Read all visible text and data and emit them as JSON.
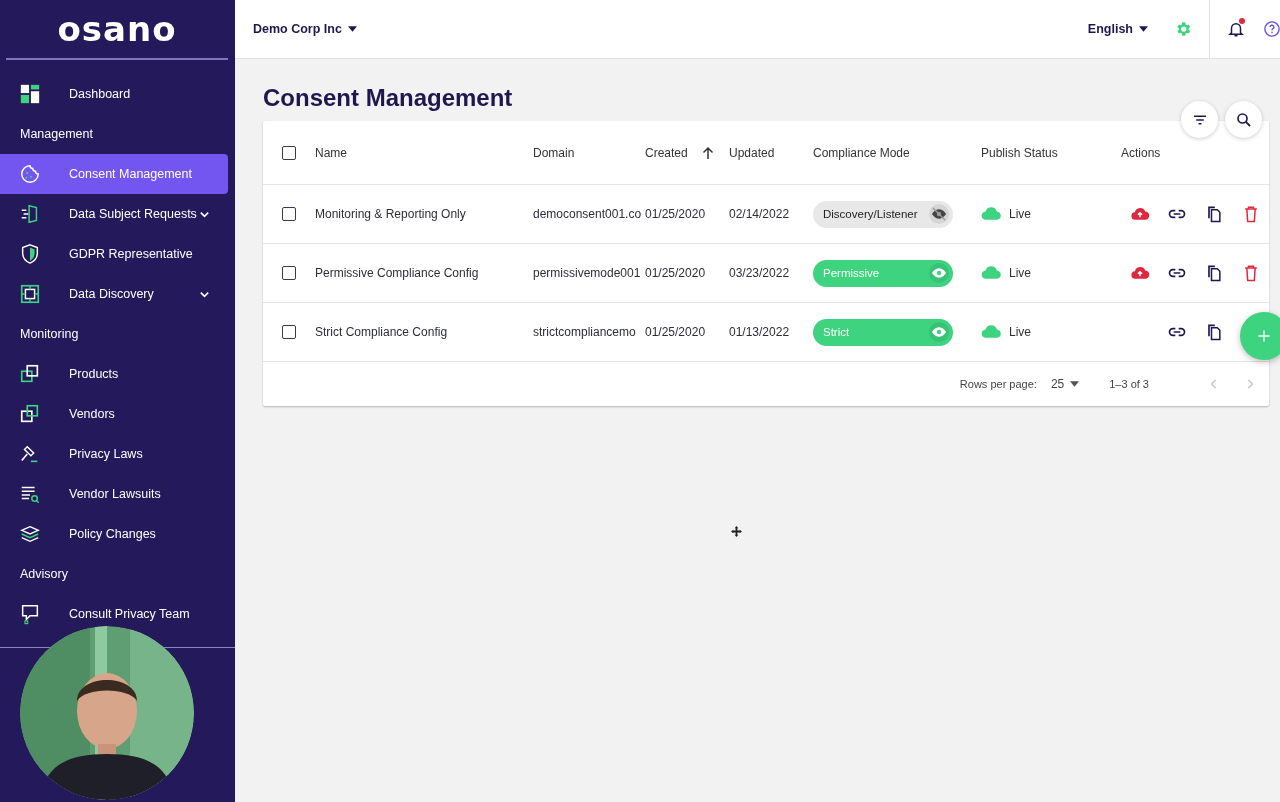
{
  "sidebar": {
    "logo": "osano",
    "items": [
      {
        "kind": "item",
        "label": "Dashboard",
        "selected": false
      },
      {
        "kind": "section",
        "label": "Management"
      },
      {
        "kind": "item",
        "label": "Consent Management",
        "selected": true
      },
      {
        "kind": "item",
        "label": "Data Subject Requests",
        "selected": false,
        "expanded": false
      },
      {
        "kind": "item",
        "label": "GDPR Representative",
        "selected": false
      },
      {
        "kind": "item",
        "label": "Data Discovery",
        "selected": false,
        "expanded": false
      },
      {
        "kind": "section",
        "label": "Monitoring"
      },
      {
        "kind": "item",
        "label": "Products",
        "selected": false
      },
      {
        "kind": "item",
        "label": "Vendors",
        "selected": false
      },
      {
        "kind": "item",
        "label": "Privacy Laws",
        "selected": false
      },
      {
        "kind": "item",
        "label": "Vendor Lawsuits",
        "selected": false
      },
      {
        "kind": "item",
        "label": "Policy Changes",
        "selected": false
      },
      {
        "kind": "section",
        "label": "Advisory"
      },
      {
        "kind": "item",
        "label": "Consult Privacy Team",
        "selected": false
      }
    ]
  },
  "header": {
    "organization": "Demo Corp Inc",
    "language": "English",
    "notifications_unread": true
  },
  "page": {
    "title": "Consent Management"
  },
  "table": {
    "all_checked": false,
    "columns": [
      {
        "label": "Name"
      },
      {
        "label": "Domain"
      },
      {
        "label": "Created",
        "sorted_ascending": true
      },
      {
        "label": "Updated"
      },
      {
        "label": "Compliance Mode"
      },
      {
        "label": "Publish Status"
      },
      {
        "label": "Actions"
      }
    ],
    "rows": [
      {
        "checked": false,
        "name": "Monitoring & Reporting Only",
        "domain": "democonsent001.co",
        "created": "01/25/2020",
        "updated": "02/14/2022",
        "mode": "Discovery/Listener",
        "mode_active": false,
        "status": "Live",
        "actions": [
          {
            "kind": "publish"
          },
          {
            "kind": "link"
          },
          {
            "kind": "copy"
          },
          {
            "kind": "delete"
          }
        ]
      },
      {
        "checked": false,
        "name": "Permissive Compliance Config",
        "domain": "permissivemode001",
        "created": "01/25/2020",
        "updated": "03/23/2022",
        "mode": "Permissive",
        "mode_active": true,
        "status": "Live",
        "actions": [
          {
            "kind": "publish"
          },
          {
            "kind": "link"
          },
          {
            "kind": "copy"
          },
          {
            "kind": "delete"
          }
        ]
      },
      {
        "checked": false,
        "name": "Strict Compliance Config",
        "domain": "strictcompliancemo",
        "created": "01/25/2020",
        "updated": "01/13/2022",
        "mode": "Strict",
        "mode_active": true,
        "status": "Live",
        "actions": [
          {
            "kind": "link"
          },
          {
            "kind": "copy"
          }
        ]
      }
    ],
    "pagination": {
      "rows_per_page_label": "Rows per page:",
      "rows_per_page": "25",
      "range": "1–3 of 3"
    }
  }
}
